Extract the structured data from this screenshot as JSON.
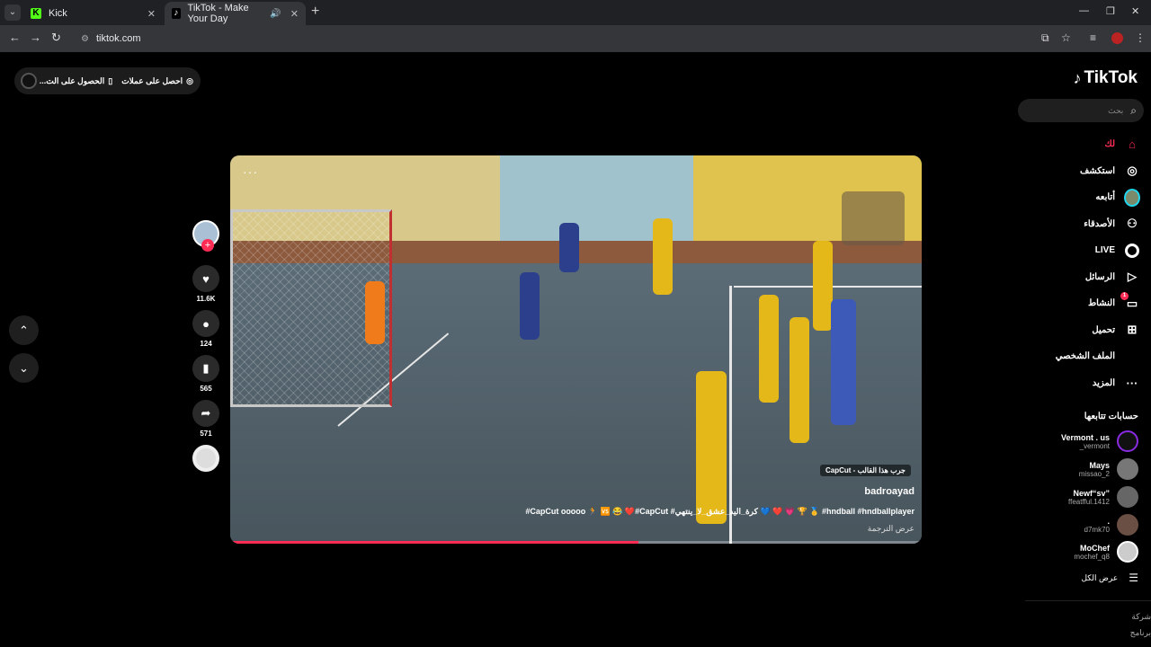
{
  "browser": {
    "tabs": [
      {
        "title": "Kick",
        "active": false
      },
      {
        "title": "TikTok - Make Your Day",
        "active": true
      }
    ],
    "url": "tiktok.com"
  },
  "top_pill": {
    "item1": "احصل على عملات",
    "item2": "الحصول على الت..."
  },
  "logo": "TikTok",
  "search": {
    "placeholder": "بحث"
  },
  "nav": [
    {
      "label": "لك",
      "icon": "home-icon"
    },
    {
      "label": "استكشف",
      "icon": "compass-icon"
    },
    {
      "label": "أتابعه",
      "icon": "avatar-icon"
    },
    {
      "label": "الأصدقاء",
      "icon": "friends-icon"
    },
    {
      "label": "LIVE",
      "icon": "live-icon"
    },
    {
      "label": "الرسائل",
      "icon": "send-icon"
    },
    {
      "label": "النشاط",
      "icon": "activity-icon",
      "badge": "1"
    },
    {
      "label": "تحميل",
      "icon": "upload-icon"
    },
    {
      "label": "الملف الشخصي",
      "icon": "profile-icon"
    },
    {
      "label": "المزيد",
      "icon": "more-icon"
    }
  ],
  "following": {
    "title": "حسابات تتابعها",
    "accounts": [
      {
        "name": "Vermont . us",
        "handle": "_vermont"
      },
      {
        "name": "Mays",
        "handle": "missao_2"
      },
      {
        "name": "Newf“sv”",
        "handle": "ffeatfful.1412"
      },
      {
        "name": ".",
        "handle": "d7mk70"
      },
      {
        "name": "MoChef",
        "handle": "mochef_q8"
      }
    ],
    "see_all": "عرض الكل"
  },
  "footer": [
    "شركة",
    "برنامج"
  ],
  "video": {
    "capcut_tag": "CapCut - جرب هذا القالب",
    "author": "badroayad",
    "caption": "#CapCut ooooo 🏃 🆚 😂 ❤️#CapCut #كرة_اليد_عشق_لا_ينتهي 💙 ❤️ 💗 🏆 🥇 #hndball #hndballplayer",
    "translate": "عرض الترجمة",
    "progress": 0.59
  },
  "actions": {
    "likes": "11.6K",
    "comments": "124",
    "saves": "565",
    "shares": "571"
  },
  "colors": {
    "accent": "#fe2c55",
    "background": "#000000"
  }
}
